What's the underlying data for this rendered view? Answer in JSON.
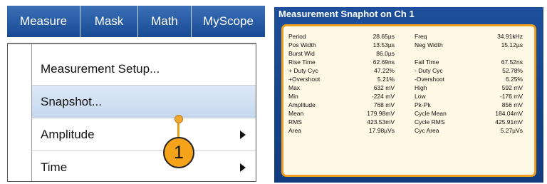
{
  "menubar": {
    "items": [
      {
        "label": "Measure"
      },
      {
        "label": "Mask"
      },
      {
        "label": "Math"
      },
      {
        "label": "MyScope"
      }
    ]
  },
  "dropdown": {
    "items": [
      {
        "label": "Measurement Setup...",
        "submenu": false,
        "highlighted": false
      },
      {
        "label": "Snapshot...",
        "submenu": false,
        "highlighted": true
      },
      {
        "label": "Amplitude",
        "submenu": true,
        "highlighted": false
      },
      {
        "label": "Time",
        "submenu": true,
        "highlighted": false
      }
    ]
  },
  "callout": {
    "number": "1",
    "color": "#f5a31a"
  },
  "snapshot": {
    "title": "Measurement Snaphot on Ch 1",
    "rows": [
      {
        "l1": "Period",
        "v1": "28.65µs",
        "l2": "Freq",
        "v2": "34.91kHz"
      },
      {
        "l1": "Pos Width",
        "v1": "13.53µs",
        "l2": "Neg Width",
        "v2": "15.12µs"
      },
      {
        "l1": "Burst Wid",
        "v1": "86.0µs",
        "l2": "",
        "v2": ""
      },
      {
        "l1": "Rise Time",
        "v1": "62.69ns",
        "l2": "Fall Time",
        "v2": "67.52ns"
      },
      {
        "l1": "+ Duty Cyc",
        "v1": "47.22%",
        "l2": "- Duty Cyc",
        "v2": "52.78%"
      },
      {
        "l1": "+Overshoot",
        "v1": "5.21%",
        "l2": "-Overshoot",
        "v2": "6.25%"
      },
      {
        "l1": "Max",
        "v1": "632 mV",
        "l2": "High",
        "v2": "592 mV"
      },
      {
        "l1": "Min",
        "v1": "-224 mV",
        "l2": "Low",
        "v2": "-176 mV"
      },
      {
        "l1": "Amplitude",
        "v1": "768 mV",
        "l2": "Pk-Pk",
        "v2": "856 mV"
      },
      {
        "l1": "Mean",
        "v1": "179.98mV",
        "l2": "Cycle Mean",
        "v2": "184.04mV"
      },
      {
        "l1": "RMS",
        "v1": "423.53mV",
        "l2": "Cycle RMS",
        "v2": "425.91mV"
      },
      {
        "l1": "Area",
        "v1": "17.98µVs",
        "l2": "Cyc Area",
        "v2": "5.27µVs"
      }
    ]
  },
  "colors": {
    "menubar": "#174a93",
    "highlight": "#c6d8ef",
    "panel_border": "#f0a020",
    "panel_bg": "#fff8e4"
  }
}
